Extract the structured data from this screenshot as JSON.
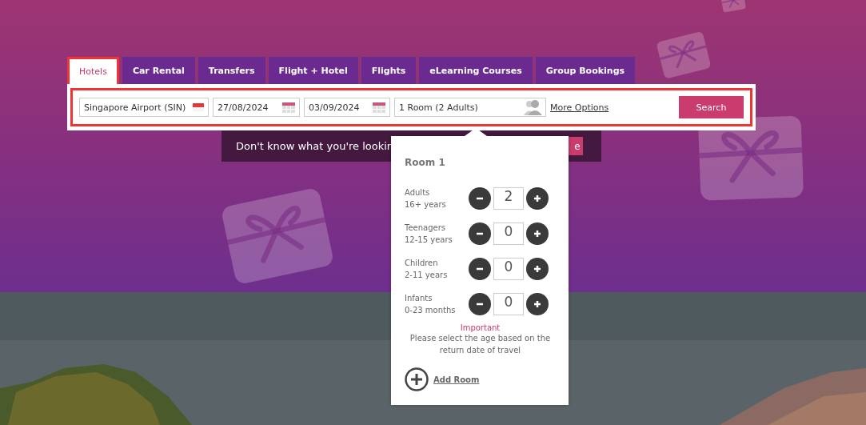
{
  "tabs": [
    {
      "label": "Hotels",
      "selected": true
    },
    {
      "label": "Car Rental",
      "selected": false
    },
    {
      "label": "Transfers",
      "selected": false
    },
    {
      "label": "Flight + Hotel",
      "selected": false
    },
    {
      "label": "Flights",
      "selected": false
    },
    {
      "label": "eLearning Courses",
      "selected": false
    },
    {
      "label": "Group Bookings",
      "selected": false
    }
  ],
  "search_form": {
    "highlighted": true,
    "destination": "Singapore Airport (SIN)",
    "check_in": "27/08/2024",
    "check_out": "03/09/2024",
    "guests": "1 Room (2 Adults)",
    "more_options": "More Options",
    "search_button": "Search"
  },
  "banner": {
    "text": "Don't know what you're lookin",
    "button": "e"
  },
  "room_popover": {
    "title": "Room 1",
    "rows": [
      {
        "label": "Adults",
        "sublabel": "16+ years",
        "value": "2"
      },
      {
        "label": "Teenagers",
        "sublabel": "12-15 years",
        "value": "0"
      },
      {
        "label": "Children",
        "sublabel": "2-11 years",
        "value": "0"
      },
      {
        "label": "Infants",
        "sublabel": "0-23 months",
        "value": "0"
      }
    ],
    "important": "Important",
    "note": "Please select the age based on the return date of travel",
    "add_room": "Add Room"
  }
}
